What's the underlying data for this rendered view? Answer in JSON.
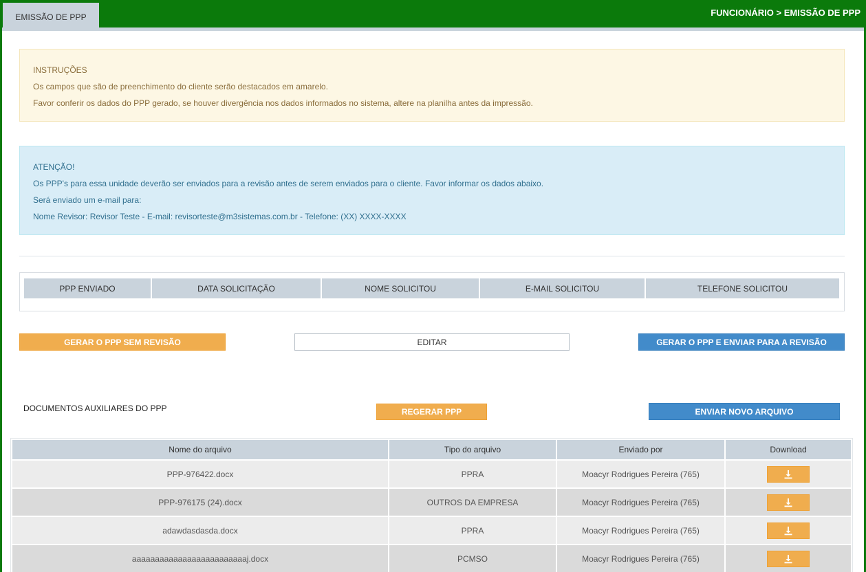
{
  "header": {
    "tab_label": "EMISSÃO DE PPP",
    "breadcrumb": "FUNCIONÁRIO > EMISSÃO DE PPP"
  },
  "instructions": {
    "title": "INSTRUÇÕES",
    "line1": "Os campos que são de preenchimento do cliente serão destacados em amarelo.",
    "line2": "Favor conferir os dados do PPP gerado, se houver divergência nos dados informados no sistema, altere na planilha antes da impressão."
  },
  "attention": {
    "title": "ATENÇÃO!",
    "line1": "Os PPP's para essa unidade deverão ser enviados para a revisão antes de serem enviados para o cliente. Favor informar os dados abaixo.",
    "line2": "Será enviado um e-mail para:",
    "line3": "Nome Revisor: Revisor Teste - E-mail: revisorteste@m3sistemas.com.br - Telefone: (XX) XXXX-XXXX"
  },
  "review_table": {
    "columns": [
      "PPP ENVIADO",
      "DATA SOLICITAÇÃO",
      "NOME SOLICITOU",
      "E-MAIL SOLICITOU",
      "TELEFONE SOLICITOU"
    ]
  },
  "actions": {
    "generate_no_review": "GERAR O PPP SEM REVISÃO",
    "edit": "EDITAR",
    "generate_and_review": "GERAR O PPP E ENVIAR PARA A REVISÃO"
  },
  "aux_docs": {
    "title": "DOCUMENTOS AUXILIARES DO PPP",
    "regenerate": "REGERAR PPP",
    "upload_new": "ENVIAR NOVO ARQUIVO",
    "columns": [
      "Nome do arquivo",
      "Tipo do arquivo",
      "Enviado por",
      "Download"
    ],
    "rows": [
      {
        "name": "PPP-976422.docx",
        "type": "PPRA",
        "sent_by": "Moacyr Rodrigues Pereira (765)"
      },
      {
        "name": "PPP-976175 (24).docx",
        "type": "OUTROS DA EMPRESA",
        "sent_by": "Moacyr Rodrigues Pereira (765)"
      },
      {
        "name": "adawdasdasda.docx",
        "type": "PPRA",
        "sent_by": "Moacyr Rodrigues Pereira (765)"
      },
      {
        "name": "aaaaaaaaaaaaaaaaaaaaaaaaaj.docx",
        "type": "PCMSO",
        "sent_by": "Moacyr Rodrigues Pereira (765)"
      }
    ]
  },
  "colors": {
    "brand_green": "#0b7a0b",
    "orange": "#f0ad4e",
    "blue": "#428bca"
  },
  "icons": {
    "download": "download-icon"
  }
}
